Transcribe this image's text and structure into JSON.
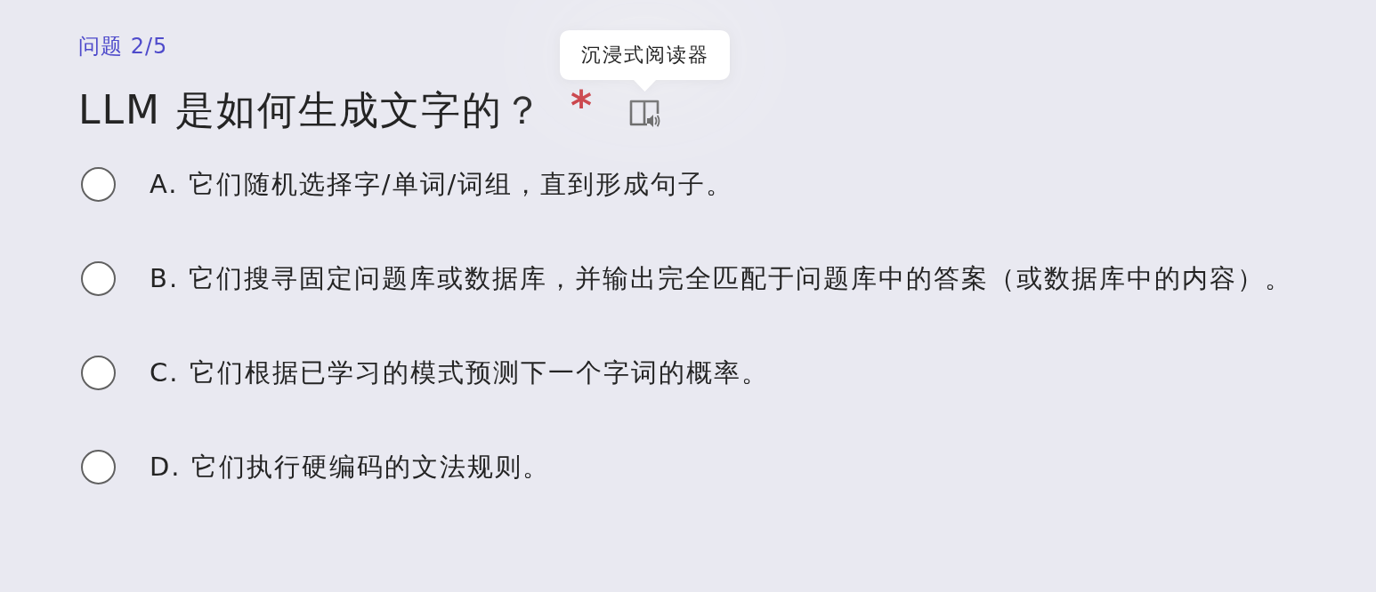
{
  "question": {
    "counter": "问题 2/5",
    "title": "LLM 是如何生成文字的？",
    "required_mark": "*",
    "reader_button": {
      "tooltip": "沉浸式阅读器"
    }
  },
  "options": [
    {
      "label": "A. 它们随机选择字/单词/词组，直到形成句子。",
      "selected": false
    },
    {
      "label": "B. 它们搜寻固定问题库或数据库，并输出完全匹配于问题库中的答案（或数据库中的内容）。",
      "selected": false
    },
    {
      "label": "C. 它们根据已学习的模式预测下一个字词的概率。",
      "selected": false
    },
    {
      "label": "D. 它们执行硬编码的文法规则。",
      "selected": false
    }
  ]
}
